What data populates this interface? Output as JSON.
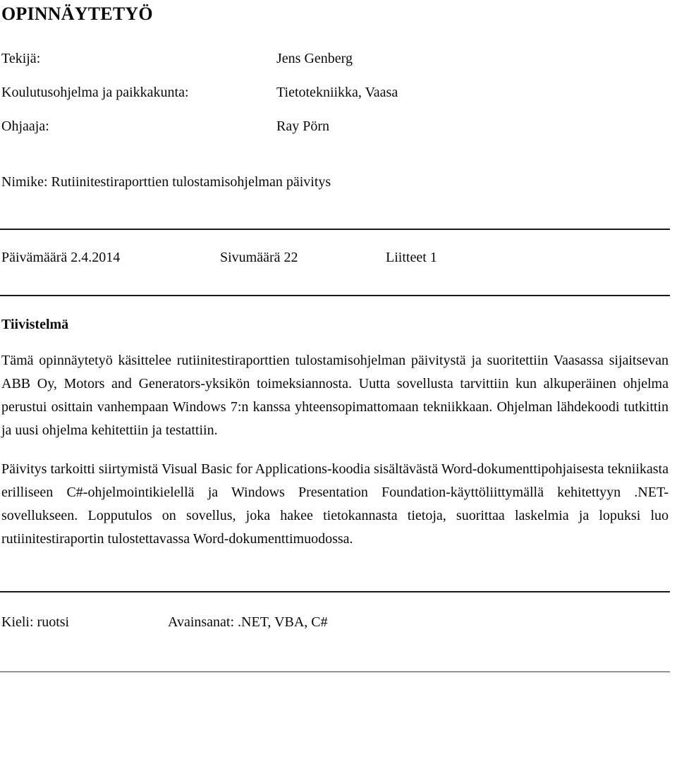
{
  "document": {
    "title": "OPINNÄYTETYÖ",
    "meta_rows": [
      {
        "label": "Tekijä:",
        "value": "Jens Genberg"
      },
      {
        "label": "Koulutusohjelma ja paikkakunta:",
        "value": "Tietotekniikka, Vaasa"
      },
      {
        "label": "Ohjaaja:",
        "value": "Ray Pörn"
      }
    ],
    "nimike_line": "Nimike: Rutiinitestiraporttien tulostamisohjelman päivitys",
    "stats": {
      "date": "Päivämäärä 2.4.2014",
      "pages": "Sivumäärä 22",
      "attachments": "Liitteet 1"
    },
    "abstract": {
      "heading": "Tiivistelmä",
      "paragraphs": [
        "Tämä opinnäytetyö käsittelee rutiinitestiraporttien tulostamisohjelman päivitystä ja suoritettiin Vaasassa sijaitsevan ABB Oy, Motors and Generators-yksikön toimeksiannosta. Uutta sovellusta tarvittiin kun alkuperäinen ohjelma perustui osittain vanhempaan Windows 7:n kanssa yhteensopimattomaan tekniikkaan. Ohjelman lähdekoodi tutkittin ja uusi ohjelma kehitettiin ja testattiin.",
        "Päivitys tarkoitti siirtymistä Visual Basic for Applications-koodia sisältävästä Word-dokumenttipohjaisesta tekniikasta erilliseen C#-ohjelmointikielellä ja Windows Presentation Foundation-käyttöliittymällä kehitettyyn .NET-sovellukseen. Lopputulos on sovellus, joka hakee tietokannasta tietoja, suorittaa laskelmia ja lopuksi luo rutiinitestiraportin tulostettavassa Word-dokumenttimuodossa."
      ]
    },
    "footer": {
      "language": "Kieli: ruotsi",
      "keywords": "Avainsanat: .NET, VBA, C#"
    },
    "colors": {
      "text": "#0a0a0a",
      "rule": "#1a1a1a",
      "background": "#ffffff"
    }
  }
}
